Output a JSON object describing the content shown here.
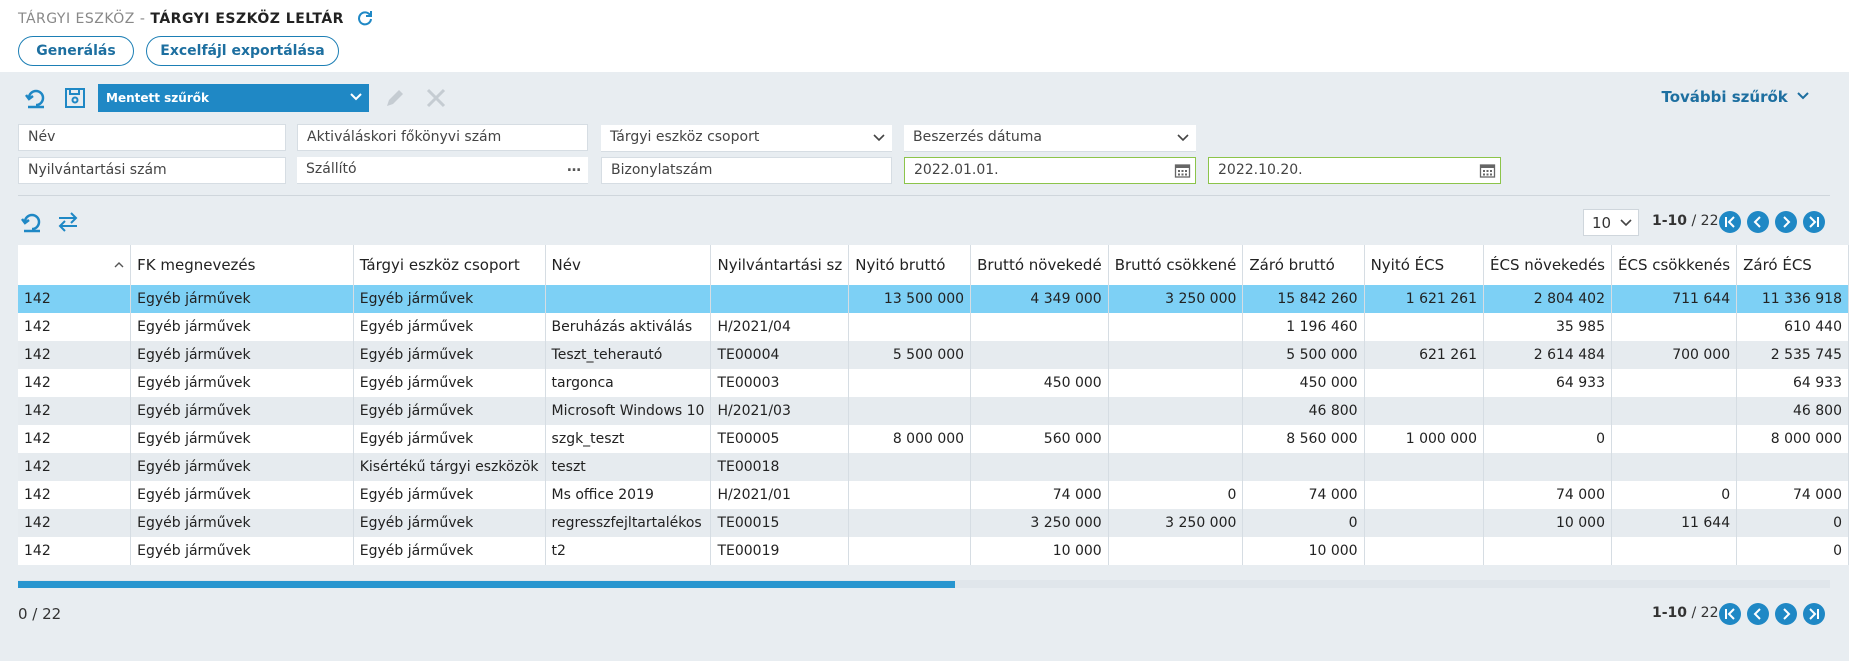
{
  "header": {
    "breadcrumb_prefix": "TÁRGYI ESZKÖZ -",
    "title": "TÁRGYI ESZKÖZ LELTÁR"
  },
  "actions": {
    "generate_label": "Generálás",
    "export_label": "Excelfájl exportálása"
  },
  "filters": {
    "saved_filters_label": "Mentett szűrők",
    "more_filters_label": "További szűrők",
    "name_placeholder": "Név",
    "gl_account_placeholder": "Aktiváláskori főkönyvi szám",
    "asset_group_placeholder": "Tárgyi eszköz csoport",
    "purchase_date_placeholder": "Beszerzés dátuma",
    "register_no_placeholder": "Nyilvántartási szám",
    "supplier_placeholder": "Szállító",
    "document_no_placeholder": "Bizonylatszám",
    "date_from": "2022.01.01.",
    "date_to": "2022.10.20."
  },
  "pagination": {
    "page_size": "10",
    "range": "1-10",
    "separator": " / ",
    "total": "22"
  },
  "table": {
    "columns": [
      "",
      "FK megnevezés",
      "Tárgyi eszköz csoport",
      "Név",
      "Nyilvántartási sz",
      "Nyitó bruttó",
      "Bruttó növekedé",
      "Bruttó csökkené",
      "Záró bruttó",
      "Nyitó ÉCS",
      "ÉCS növekedés",
      "ÉCS csökkenés",
      "Záró ÉCS"
    ],
    "rows": [
      [
        "142",
        "Egyéb járművek",
        "Egyéb járművek",
        "",
        "",
        "13 500 000",
        "4 349 000",
        "3 250 000",
        "15 842 260",
        "1 621 261",
        "2 804 402",
        "711 644",
        "11 336 918"
      ],
      [
        "142",
        "Egyéb járművek",
        "Egyéb járművek",
        "Beruházás aktiválás",
        "H/2021/04",
        "",
        "",
        "",
        "1 196 460",
        "",
        "35 985",
        "",
        "610 440"
      ],
      [
        "142",
        "Egyéb járművek",
        "Egyéb járművek",
        "Teszt_teherautó",
        "TE00004",
        "5 500 000",
        "",
        "",
        "5 500 000",
        "621 261",
        "2 614 484",
        "700 000",
        "2 535 745"
      ],
      [
        "142",
        "Egyéb járművek",
        "Egyéb járművek",
        "targonca",
        "TE00003",
        "",
        "450 000",
        "",
        "450 000",
        "",
        "64 933",
        "",
        "64 933"
      ],
      [
        "142",
        "Egyéb járművek",
        "Egyéb járművek",
        "Microsoft Windows 10",
        "H/2021/03",
        "",
        "",
        "",
        "46 800",
        "",
        "",
        "",
        "46 800"
      ],
      [
        "142",
        "Egyéb járművek",
        "Egyéb járművek",
        "szgk_teszt",
        "TE00005",
        "8 000 000",
        "560 000",
        "",
        "8 560 000",
        "1 000 000",
        "0",
        "",
        "8 000 000"
      ],
      [
        "142",
        "Egyéb járművek",
        "Kisértékű tárgyi eszközök",
        "teszt",
        "TE00018",
        "",
        "",
        "",
        "",
        "",
        "",
        "",
        ""
      ],
      [
        "142",
        "Egyéb járművek",
        "Egyéb járművek",
        "Ms office 2019",
        "H/2021/01",
        "",
        "74 000",
        "0",
        "74 000",
        "",
        "74 000",
        "0",
        "74 000"
      ],
      [
        "142",
        "Egyéb járművek",
        "Egyéb járművek",
        "regresszfejltartalékos",
        "TE00015",
        "",
        "3 250 000",
        "3 250 000",
        "0",
        "",
        "10 000",
        "11 644",
        "0"
      ],
      [
        "142",
        "Egyéb járművek",
        "Egyéb járművek",
        "t2",
        "TE00019",
        "",
        "10 000",
        "",
        "10 000",
        "",
        "",
        "",
        "0"
      ]
    ]
  },
  "footer": {
    "selected_count": "0  /  22"
  },
  "colors": {
    "accent": "#1f88c5",
    "selected_row": "#7dd0f5",
    "date_border": "#8cc44a"
  }
}
